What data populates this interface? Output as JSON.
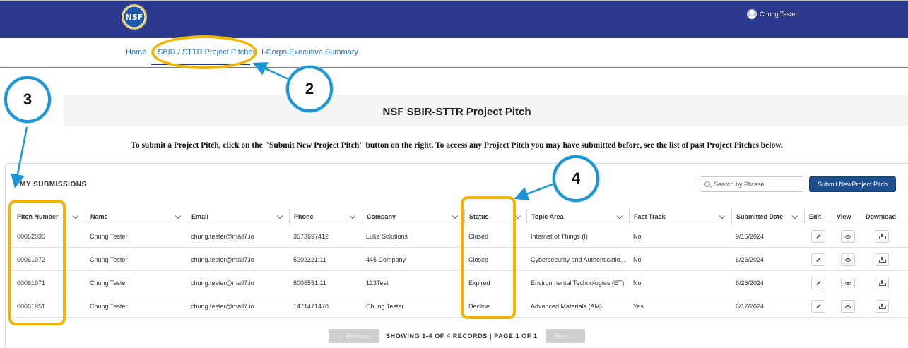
{
  "header": {
    "logo_text": "NSF",
    "user_name": "Chung Tester"
  },
  "nav": {
    "items": [
      {
        "label": "Home"
      },
      {
        "label": "SBIR / STTR Project Pitches"
      },
      {
        "label": "I-Corps Executive Summary"
      }
    ]
  },
  "page": {
    "title": "NSF SBIR-STTR Project Pitch",
    "instructions": "To submit a Project Pitch, click on the \"Submit New Project Pitch\" button on the right. To access any Project Pitch you may have submitted before, see the list of past Project Pitches below."
  },
  "submissions": {
    "title": "MY SUBMISSIONS",
    "search_placeholder": "Search by Phrase",
    "submit_label": "Submit NewProject Pitch",
    "columns": [
      "Pitch Number",
      "Name",
      "Email",
      "Phone",
      "Company",
      "Status",
      "Topic Area",
      "Fast Track",
      "Submitted Date",
      "Edit",
      "View",
      "Download"
    ],
    "rows": [
      {
        "pitch": "00062030",
        "name": "Chung Tester",
        "email": "chung.tester@mail7.io",
        "phone": "3573697412",
        "company": "Luke Solutions",
        "status": "Closed",
        "topic": "Internet of Things (I)",
        "fast": "No",
        "date": "9/16/2024"
      },
      {
        "pitch": "00061972",
        "name": "Chung Tester",
        "email": "chung.tester@mail7.io",
        "phone": "5002221:11",
        "company": "445 Company",
        "status": "Closed",
        "topic": "Cybersecurity and Authenticatio...",
        "fast": "No",
        "date": "6/26/2024"
      },
      {
        "pitch": "00061971",
        "name": "Chung Tester",
        "email": "chung.tester@mail7.io",
        "phone": "8005551:11",
        "company": "123Test",
        "status": "Expired",
        "topic": "Environmental Technologies (ET)",
        "fast": "No",
        "date": "6/26/2024"
      },
      {
        "pitch": "00061951",
        "name": "Chung Tester",
        "email": "chung.tester@mail7.io",
        "phone": "1471471478",
        "company": "Chung Tester",
        "status": "Decline",
        "topic": "Advanced Materials (AM)",
        "fast": "Yes",
        "date": "6/17/2024"
      }
    ],
    "pagination": {
      "prev_label": "← Previous",
      "status": "SHOWING 1-4 OF 4 RECORDS | PAGE 1 OF 1",
      "next_label": "Next →"
    }
  },
  "annotations": {
    "callouts": [
      "2",
      "3",
      "4"
    ],
    "highlight_color": "#f2b400",
    "callout_color": "#1b95d3"
  },
  "colors": {
    "header_bg": "#2b3a8f",
    "link": "#1a73b8",
    "primary_button": "#1d4f8c"
  }
}
